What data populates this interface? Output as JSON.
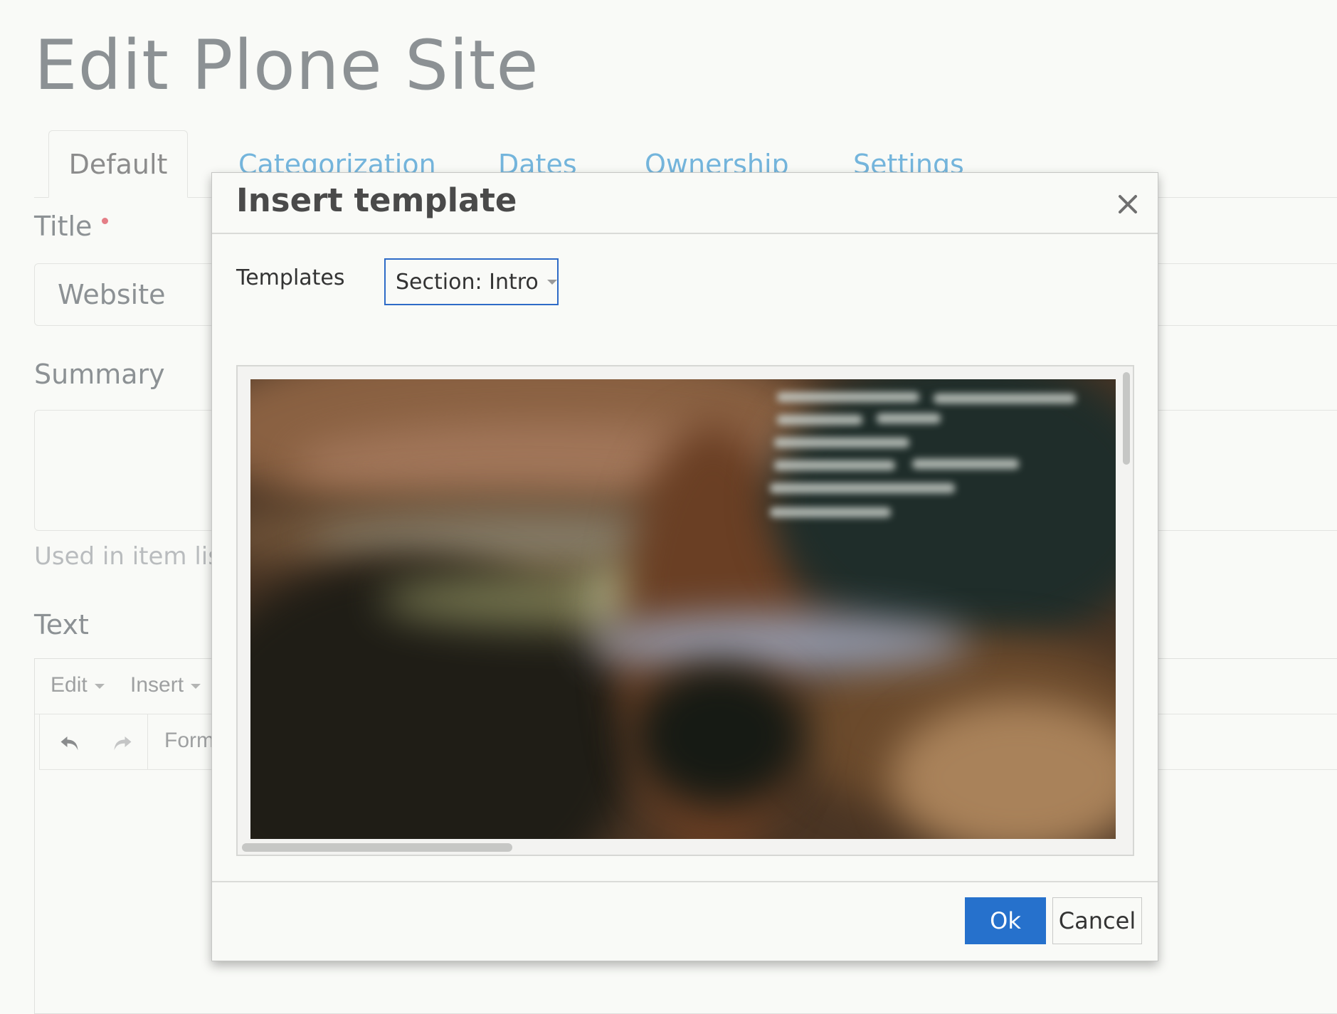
{
  "page": {
    "title": "Edit Plone Site"
  },
  "tabs": [
    {
      "label": "Default",
      "active": true
    },
    {
      "label": "Categorization"
    },
    {
      "label": "Dates"
    },
    {
      "label": "Ownership"
    },
    {
      "label": "Settings"
    }
  ],
  "form": {
    "title_label": "Title",
    "title_value": "Website",
    "summary_label": "Summary",
    "summary_help": "Used in item list",
    "text_label": "Text"
  },
  "editor": {
    "menu": {
      "edit": "Edit",
      "insert": "Insert"
    },
    "toolbar": {
      "format": "Form"
    }
  },
  "modal": {
    "title": "Insert template",
    "templates_label": "Templates",
    "selected_template": "Section: Intro",
    "ok_label": "Ok",
    "cancel_label": "Cancel"
  },
  "colors": {
    "primary_button": "#2671cc",
    "link_tab": "#74b5dc",
    "required": "#e47e86"
  }
}
